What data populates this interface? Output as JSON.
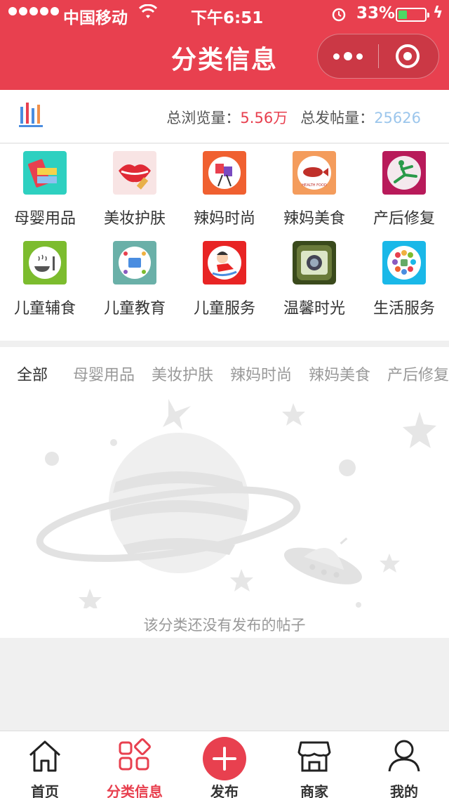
{
  "status_bar": {
    "carrier": "中国移动",
    "time": "下午6:51",
    "battery_pct": "33%",
    "battery_level": 0.33
  },
  "nav": {
    "title": "分类信息"
  },
  "stats": {
    "views_label": "总浏览量：",
    "views_value": "5.56万",
    "posts_label": "总发帖量：",
    "posts_value": "25626"
  },
  "categories": [
    {
      "label": "母婴用品",
      "icon": "color-swatch-icon",
      "color": "#2ed0c0"
    },
    {
      "label": "美妆护肤",
      "icon": "lips-icon",
      "color": "#f8e4e4"
    },
    {
      "label": "辣妈时尚",
      "icon": "fashion-woman-icon",
      "color": "#f06030"
    },
    {
      "label": "辣妈美食",
      "icon": "fish-dish-icon",
      "color": "#f49c5c"
    },
    {
      "label": "产后修复",
      "icon": "yoga-icon",
      "color": "#b81a5a"
    },
    {
      "label": "儿童辅食",
      "icon": "baby-food-icon",
      "color": "#7cbc2e"
    },
    {
      "label": "儿童教育",
      "icon": "education-icon",
      "color": "#6ab0a8"
    },
    {
      "label": "儿童服务",
      "icon": "kid-hero-icon",
      "color": "#e82424"
    },
    {
      "label": "温馨时光",
      "icon": "camera-icon",
      "color": "#3a4a1c"
    },
    {
      "label": "生活服务",
      "icon": "life-services-icon",
      "color": "#1ab8e8"
    }
  ],
  "tabs": [
    "全部",
    "母婴用品",
    "美妆护肤",
    "辣妈时尚",
    "辣妈美食",
    "产后修复"
  ],
  "empty_text": "该分类还没有发布的帖子",
  "tabbar": [
    {
      "label": "首页",
      "icon": "home-icon"
    },
    {
      "label": "分类信息",
      "icon": "category-icon",
      "active": true
    },
    {
      "label": "发布",
      "icon": "plus-icon"
    },
    {
      "label": "商家",
      "icon": "store-icon"
    },
    {
      "label": "我的",
      "icon": "user-icon"
    }
  ],
  "colors": {
    "brand": "#e8404f",
    "views": "#e8404f",
    "posts": "#9cc6ec"
  }
}
